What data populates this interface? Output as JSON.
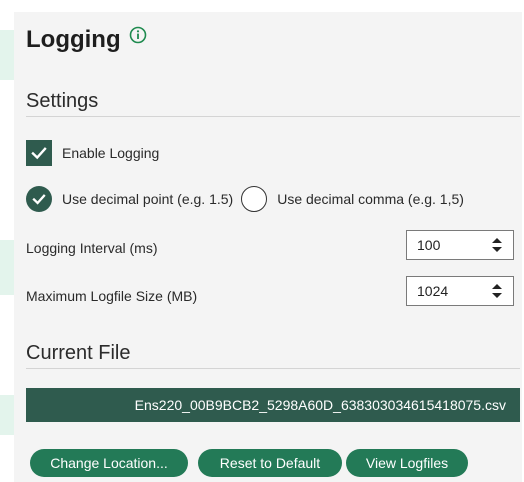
{
  "header": {
    "title": "Logging",
    "info_icon": "info-icon"
  },
  "settings": {
    "title": "Settings",
    "enable_logging": {
      "label": "Enable Logging",
      "checked": true
    },
    "decimal_point": {
      "label": "Use decimal point (e.g. 1.5)",
      "selected": true
    },
    "decimal_comma": {
      "label": "Use decimal comma (e.g. 1,5)",
      "selected": false
    },
    "logging_interval": {
      "label": "Logging Interval (ms)",
      "value": "100"
    },
    "max_logfile_size": {
      "label": "Maximum Logfile Size (MB)",
      "value": "1024"
    }
  },
  "current_file": {
    "title": "Current File",
    "filename": "Ens220_00B9BCB2_5298A60D_638303034615418075.csv"
  },
  "buttons": {
    "change_location": "Change Location...",
    "reset_default": "Reset to Default",
    "view_logfiles": "View Logfiles"
  },
  "colors": {
    "accent_dark": "#2f5b4e",
    "button_green": "#237a57",
    "panel_bg": "#f4f4f4"
  }
}
